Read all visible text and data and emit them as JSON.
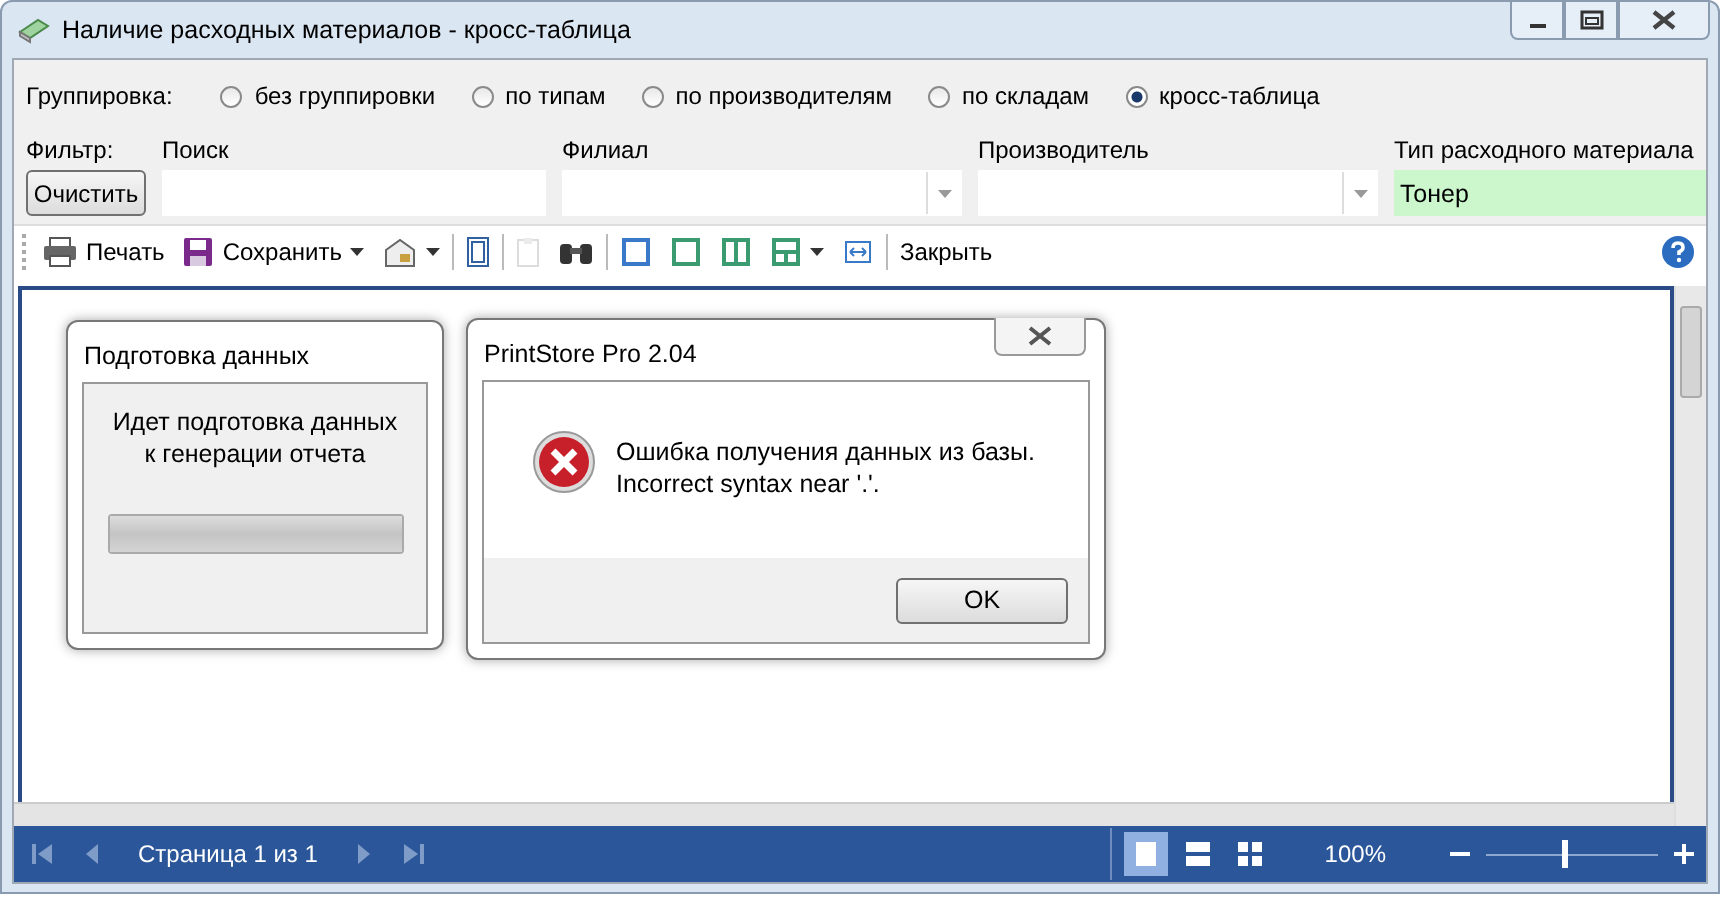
{
  "window": {
    "title": "Наличие расходных материалов - кросс-таблица"
  },
  "grouping": {
    "label": "Группировка:",
    "options": [
      {
        "label": "без группировки",
        "selected": false
      },
      {
        "label": "по типам",
        "selected": false
      },
      {
        "label": "по производителям",
        "selected": false
      },
      {
        "label": "по складам",
        "selected": false
      },
      {
        "label": "кросс-таблица",
        "selected": true
      }
    ]
  },
  "filter": {
    "label": "Фильтр:",
    "clear_button": "Очистить",
    "fields": [
      {
        "kind": "text",
        "label": "Поиск"
      },
      {
        "kind": "combo",
        "label": "Филиал"
      },
      {
        "kind": "combo",
        "label": "Производитель"
      },
      {
        "kind": "text",
        "label": "Тип расходного материала",
        "value": "Тонер"
      }
    ]
  },
  "toolbar": {
    "buttons": [
      {
        "label": "Печать",
        "dropdown": false,
        "disabled": false
      },
      {
        "label": "Сохранить",
        "dropdown": true,
        "disabled": false
      },
      {
        "dropdown": true,
        "disabled": false
      },
      {
        "dropdown": false,
        "disabled": false
      },
      {
        "dropdown": false,
        "disabled": true
      },
      {
        "dropdown": false,
        "disabled": false
      },
      {
        "dropdown": false,
        "disabled": false
      },
      {
        "dropdown": false,
        "disabled": false
      },
      {
        "dropdown": false,
        "disabled": false
      },
      {
        "dropdown": true,
        "disabled": false
      },
      {
        "dropdown": false,
        "disabled": false
      },
      {
        "label": "Закрыть",
        "dropdown": false,
        "disabled": false
      }
    ]
  },
  "progress_dialog": {
    "title": "Подготовка данных",
    "message_lines": [
      "Идет подготовка данных",
      "к генерации отчета"
    ],
    "level": 1
  },
  "error_dialog": {
    "title": "PrintStore Pro 2.04",
    "message_lines": [
      "Ошибка получения данных из базы.",
      "Incorrect syntax near '.'."
    ],
    "button": "OK"
  },
  "status_bar": {
    "page": "Страница 1 из 1",
    "views": [
      {
        "selected": true
      },
      {
        "selected": false
      },
      {
        "selected": false
      }
    ],
    "zoom": "100%",
    "zoom_slider": {
      "level": 0.47
    }
  }
}
